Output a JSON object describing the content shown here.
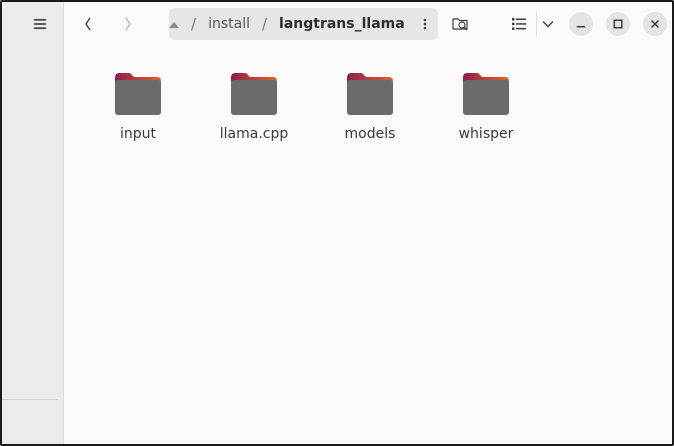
{
  "toolbar": {
    "menu_icon": "hamburger-icon",
    "back_icon": "chevron-left-icon",
    "forward_icon": "chevron-right-icon",
    "search_icon": "search-folder-icon",
    "view_icon": "list-view-icon",
    "view_options_icon": "chevron-down-icon"
  },
  "breadcrumb": {
    "segments": [
      {
        "label": "install"
      },
      {
        "label": "langtrans_llama"
      }
    ],
    "more_icon": "vertical-dots-icon"
  },
  "window_controls": {
    "minimize_icon": "minimize-icon",
    "maximize_icon": "maximize-icon",
    "close_icon": "close-icon"
  },
  "files": [
    {
      "name": "input",
      "type": "folder"
    },
    {
      "name": "llama.cpp",
      "type": "folder"
    },
    {
      "name": "models",
      "type": "folder"
    },
    {
      "name": "whisper",
      "type": "folder"
    }
  ],
  "colors": {
    "folder_body": "#6b6b6b",
    "folder_tab_start": "#8d1f4e",
    "folder_tab_end": "#e0632b"
  }
}
